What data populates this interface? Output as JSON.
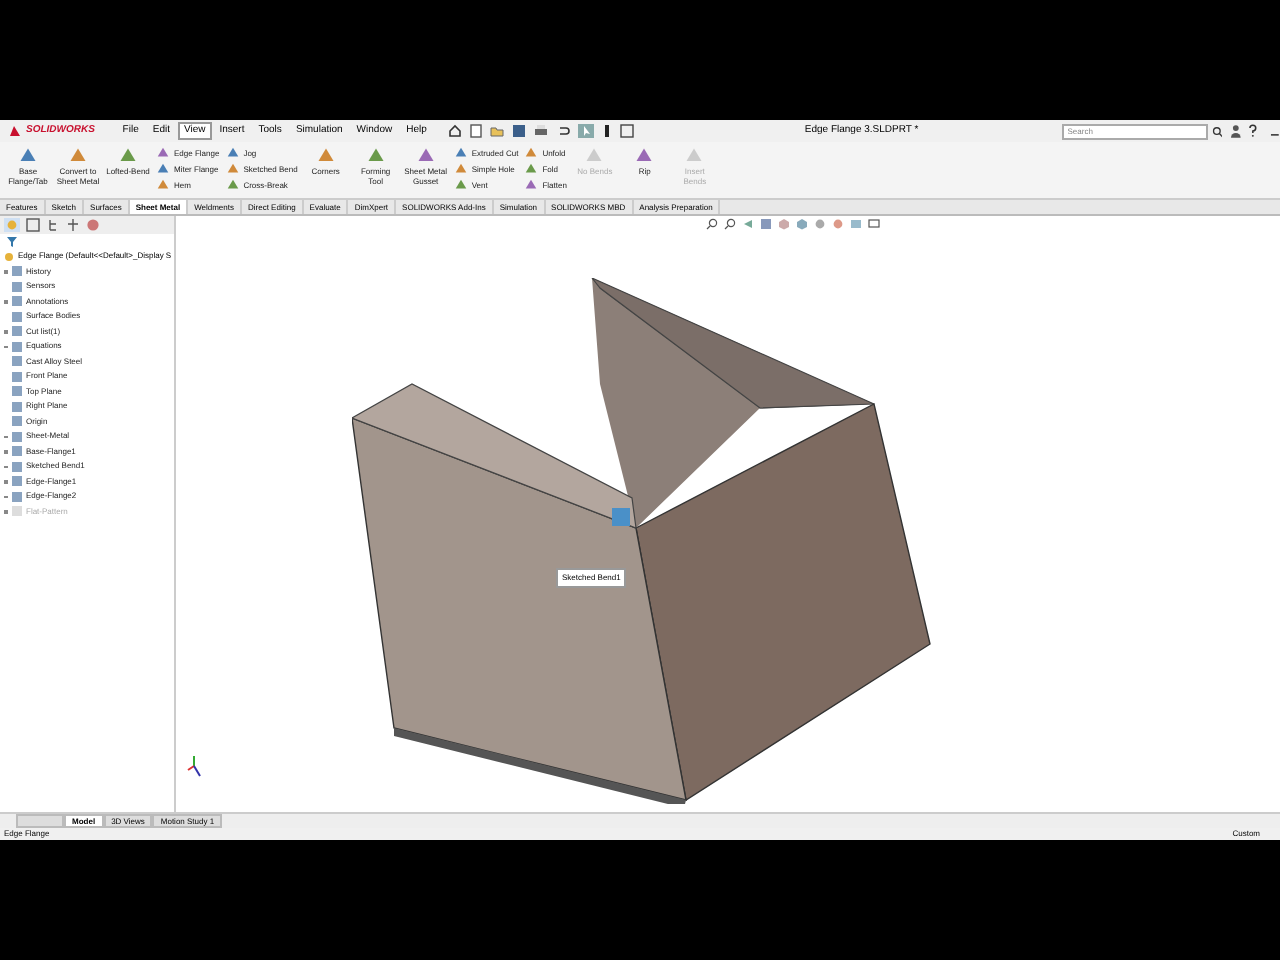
{
  "app": {
    "logo": "SOLIDWORKS",
    "document_title": "Edge Flange 3.SLDPRT *",
    "search": {
      "placeholder": "Search"
    }
  },
  "menu": [
    {
      "label": "File",
      "selected": false
    },
    {
      "label": "Edit",
      "selected": false
    },
    {
      "label": "View",
      "selected": true
    },
    {
      "label": "Insert",
      "selected": false
    },
    {
      "label": "Tools",
      "selected": false
    },
    {
      "label": "Simulation",
      "selected": false
    },
    {
      "label": "Window",
      "selected": false
    },
    {
      "label": "Help",
      "selected": false
    }
  ],
  "ribbon": [
    {
      "kind": "large",
      "items": [
        {
          "label": "Base Flange/Tab",
          "disabled": false
        }
      ]
    },
    {
      "kind": "large",
      "items": [
        {
          "label": "Convert to Sheet Metal",
          "disabled": false
        }
      ]
    },
    {
      "kind": "large",
      "items": [
        {
          "label": "Lofted-Bend",
          "disabled": false
        }
      ]
    },
    {
      "kind": "column",
      "items": [
        {
          "label": "Edge Flange",
          "disabled": false
        },
        {
          "label": "Miter Flange",
          "disabled": false
        },
        {
          "label": "Hem",
          "disabled": false
        }
      ]
    },
    {
      "kind": "column",
      "items": [
        {
          "label": "Jog",
          "disabled": false
        },
        {
          "label": "Sketched Bend",
          "disabled": false
        },
        {
          "label": "Cross-Break",
          "disabled": false
        }
      ]
    },
    {
      "kind": "large",
      "items": [
        {
          "label": "Corners",
          "disabled": false
        }
      ]
    },
    {
      "kind": "large",
      "items": [
        {
          "label": "Forming Tool",
          "disabled": false
        }
      ]
    },
    {
      "kind": "large",
      "items": [
        {
          "label": "Sheet Metal Gusset",
          "disabled": false
        }
      ]
    },
    {
      "kind": "column",
      "items": [
        {
          "label": "Extruded Cut",
          "disabled": false
        },
        {
          "label": "Simple Hole",
          "disabled": false
        },
        {
          "label": "Vent",
          "disabled": false
        }
      ]
    },
    {
      "kind": "column",
      "items": [
        {
          "label": "Unfold",
          "disabled": false
        },
        {
          "label": "Fold",
          "disabled": false
        },
        {
          "label": "Flatten",
          "disabled": false
        }
      ]
    },
    {
      "kind": "large",
      "items": [
        {
          "label": "No Bends",
          "disabled": true
        }
      ]
    },
    {
      "kind": "large",
      "items": [
        {
          "label": "Rip",
          "disabled": false
        }
      ]
    },
    {
      "kind": "large",
      "items": [
        {
          "label": "Insert Bends",
          "disabled": true
        }
      ]
    }
  ],
  "command_tabs": [
    {
      "label": "Features",
      "selected": false
    },
    {
      "label": "Sketch",
      "selected": false
    },
    {
      "label": "Surfaces",
      "selected": false
    },
    {
      "label": "Sheet Metal",
      "selected": true
    },
    {
      "label": "Weldments",
      "selected": false
    },
    {
      "label": "Direct Editing",
      "selected": false
    },
    {
      "label": "Evaluate",
      "selected": false
    },
    {
      "label": "DimXpert",
      "selected": false
    },
    {
      "label": "SOLIDWORKS Add-Ins",
      "selected": false
    },
    {
      "label": "Simulation",
      "selected": false
    },
    {
      "label": "SOLIDWORKS MBD",
      "selected": false
    },
    {
      "label": "Analysis Preparation",
      "selected": false
    }
  ],
  "feature_tree": {
    "root": "Edge Flange  (Default<<Default>_Display S",
    "items": [
      {
        "label": "History",
        "expandable": true,
        "suppressed": false
      },
      {
        "label": "Sensors",
        "expandable": false,
        "suppressed": false
      },
      {
        "label": "Annotations",
        "expandable": true,
        "suppressed": false
      },
      {
        "label": "Surface Bodies",
        "expandable": false,
        "suppressed": false
      },
      {
        "label": "Cut list(1)",
        "expandable": true,
        "suppressed": false
      },
      {
        "label": "Equations",
        "expandable": true,
        "suppressed": false
      },
      {
        "label": "Cast Alloy Steel",
        "expandable": false,
        "suppressed": false
      },
      {
        "label": "Front Plane",
        "expandable": false,
        "suppressed": false
      },
      {
        "label": "Top Plane",
        "expandable": false,
        "suppressed": false
      },
      {
        "label": "Right Plane",
        "expandable": false,
        "suppressed": false
      },
      {
        "label": "Origin",
        "expandable": false,
        "suppressed": false
      },
      {
        "label": "Sheet-Metal",
        "expandable": true,
        "suppressed": false
      },
      {
        "label": "Base-Flange1",
        "expandable": true,
        "suppressed": false
      },
      {
        "label": "Sketched Bend1",
        "expandable": true,
        "suppressed": false
      },
      {
        "label": "Edge-Flange1",
        "expandable": true,
        "suppressed": false
      },
      {
        "label": "Edge-Flange2",
        "expandable": true,
        "suppressed": false
      },
      {
        "label": "Flat-Pattern",
        "expandable": true,
        "suppressed": true
      }
    ]
  },
  "viewport": {
    "tooltip": "Sketched Bend1"
  },
  "bottom_tabs": [
    {
      "selected": false
    },
    {
      "label": "Model",
      "selected": true
    },
    {
      "label": "3D Views",
      "selected": false
    },
    {
      "label": "Motion Study 1",
      "selected": false
    }
  ],
  "status_bar": {
    "left": "Edge Flange",
    "right": "Custom"
  }
}
